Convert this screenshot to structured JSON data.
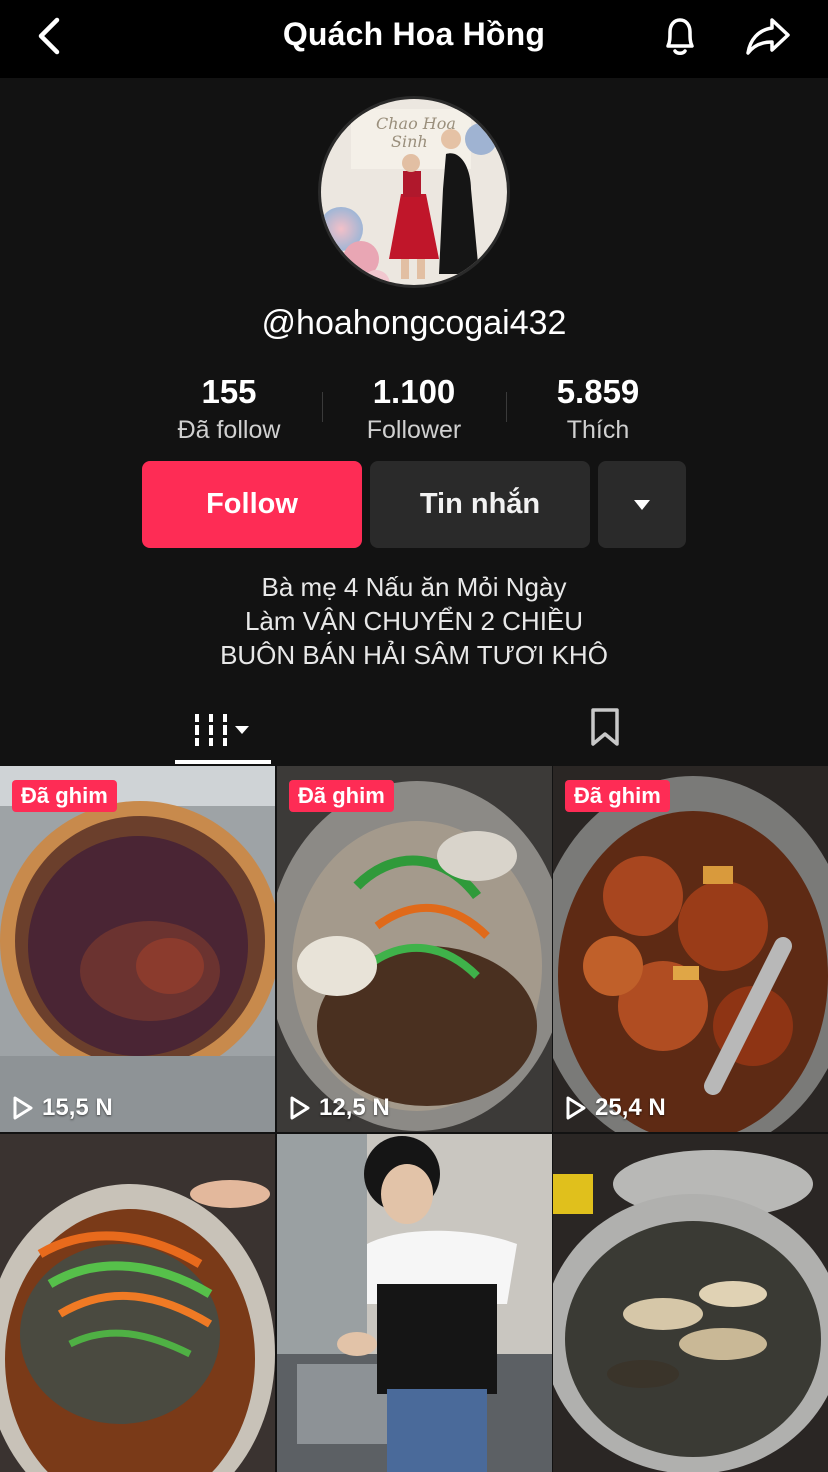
{
  "header": {
    "title": "Quách Hoa Hồng"
  },
  "profile": {
    "handle": "@hoahongcogai432",
    "stats": [
      {
        "value": "155",
        "label": "Đã follow"
      },
      {
        "value": "1.100",
        "label": "Follower"
      },
      {
        "value": "5.859",
        "label": "Thích"
      }
    ],
    "buttons": {
      "follow": "Follow",
      "message": "Tin nhắn"
    },
    "bio": [
      "Bà mẹ 4 Nấu ăn Mỏi Ngày",
      "Làm VẬN CHUYỂN 2 CHIỀU",
      "BUÔN BÁN HẢI SÂM TƯƠI KHÔ"
    ]
  },
  "tabs": {
    "videos_icon": "grid-icon",
    "saved_icon": "bookmark-icon"
  },
  "videos": [
    {
      "pinned": "Đã ghim",
      "views": "15,5 N"
    },
    {
      "pinned": "Đã ghim",
      "views": "12,5 N"
    },
    {
      "pinned": "Đã ghim",
      "views": "25,4 N"
    },
    {
      "pinned": "",
      "views": ""
    },
    {
      "pinned": "",
      "views": ""
    },
    {
      "pinned": "",
      "views": ""
    }
  ],
  "colors": {
    "accent": "#fe2c55",
    "background": "#121212",
    "button_dark": "#2a2a2a"
  }
}
